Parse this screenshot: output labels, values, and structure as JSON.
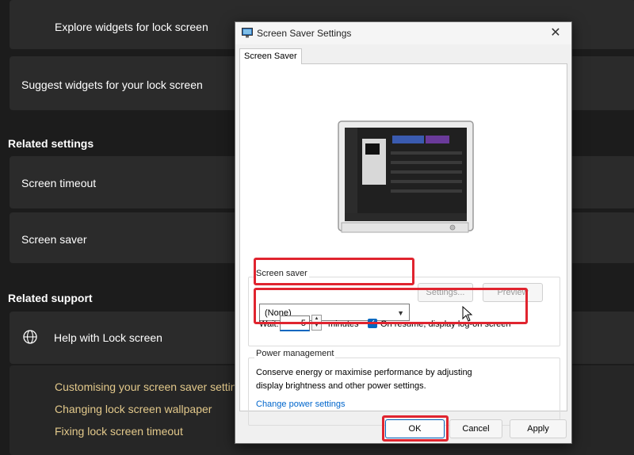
{
  "settings_page": {
    "top_items": [
      "Explore widgets for lock screen",
      "Suggest widgets for your lock screen"
    ],
    "related_settings_heading": "Related settings",
    "related_settings": [
      "Screen timeout",
      "Screen saver"
    ],
    "related_support_heading": "Related support",
    "help_label": "Help with Lock screen",
    "help_links": [
      "Customising your screen saver setting",
      "Changing lock screen wallpaper",
      "Fixing lock screen timeout"
    ]
  },
  "dialog": {
    "title": "Screen Saver Settings",
    "close_glyph": "✕",
    "tab": "Screen Saver",
    "screen_saver_group": "Screen saver",
    "selected_saver": "(None)",
    "settings_button": "Settings...",
    "preview_button": "Preview",
    "wait_label": "Wait:",
    "wait_value": "5",
    "minutes_label": "minutes",
    "resume_checkbox_label": "On resume, display log-on screen",
    "resume_checked": true,
    "power_group": "Power management",
    "power_text_line1": "Conserve energy or maximise performance by adjusting",
    "power_text_line2": "display brightness and other power settings.",
    "power_link": "Change power settings",
    "ok_button": "OK",
    "cancel_button": "Cancel",
    "apply_button": "Apply"
  },
  "colors": {
    "highlight": "#e0242f",
    "accent": "#0067c0",
    "support_link": "#e3c98b"
  }
}
